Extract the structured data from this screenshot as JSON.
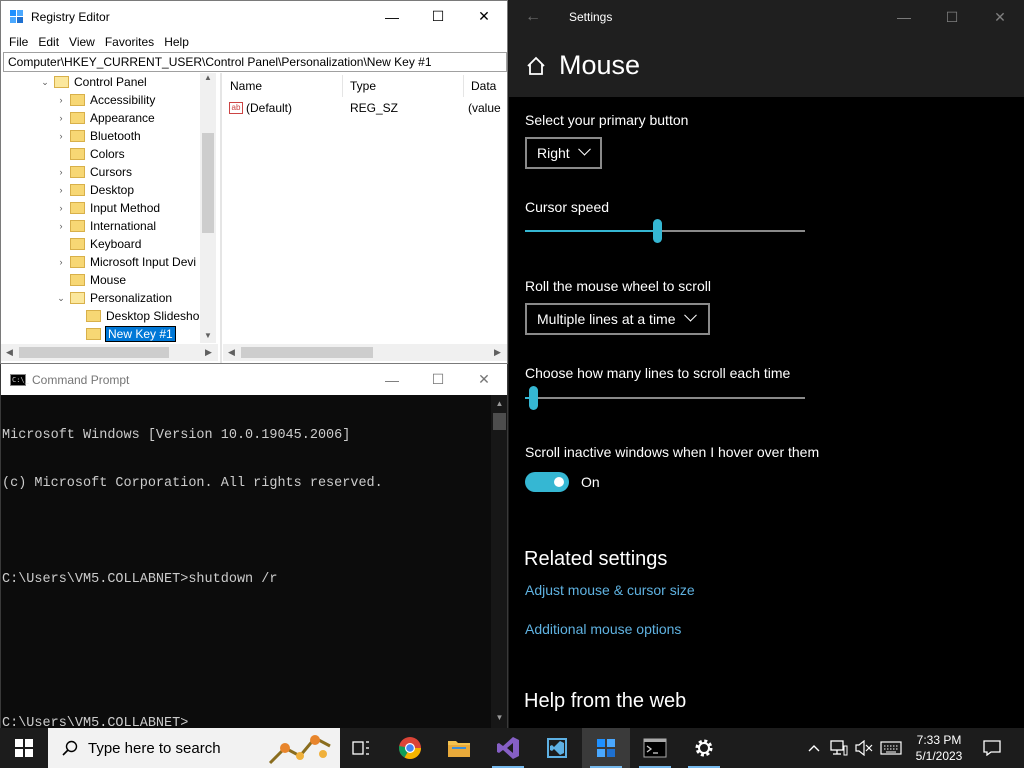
{
  "regedit": {
    "title": "Registry Editor",
    "controls": {
      "minimize": "—",
      "maximize": "☐",
      "close": "✕"
    },
    "menu": [
      "File",
      "Edit",
      "View",
      "Favorites",
      "Help"
    ],
    "address": "Computer\\HKEY_CURRENT_USER\\Control Panel\\Personalization\\New Key #1",
    "tree": [
      {
        "label": "Control Panel",
        "level": 0,
        "expander": "⌄",
        "open": true
      },
      {
        "label": "Accessibility",
        "level": 1,
        "expander": "›"
      },
      {
        "label": "Appearance",
        "level": 1,
        "expander": "›"
      },
      {
        "label": "Bluetooth",
        "level": 1,
        "expander": "›"
      },
      {
        "label": "Colors",
        "level": 1,
        "expander": ""
      },
      {
        "label": "Cursors",
        "level": 1,
        "expander": "›"
      },
      {
        "label": "Desktop",
        "level": 1,
        "expander": "›"
      },
      {
        "label": "Input Method",
        "level": 1,
        "expander": "›"
      },
      {
        "label": "International",
        "level": 1,
        "expander": "›"
      },
      {
        "label": "Keyboard",
        "level": 1,
        "expander": ""
      },
      {
        "label": "Microsoft Input Devi",
        "level": 1,
        "expander": "›"
      },
      {
        "label": "Mouse",
        "level": 1,
        "expander": ""
      },
      {
        "label": "Personalization",
        "level": 1,
        "expander": "⌄",
        "open": true
      },
      {
        "label": "Desktop Slidesho",
        "level": 2,
        "expander": ""
      },
      {
        "label": "New Key #1",
        "level": 2,
        "expander": "",
        "selected": true
      }
    ],
    "columns": [
      "Name",
      "Type",
      "Data"
    ],
    "values": [
      {
        "name": "(Default)",
        "type": "REG_SZ",
        "data": "(value",
        "icon": "ab"
      }
    ],
    "scroll_arrows": {
      "up": "▲",
      "down": "▼",
      "left": "◀",
      "right": "▶"
    }
  },
  "cmd": {
    "title": "Command Prompt",
    "icon_text": "C:\\_",
    "controls": {
      "minimize": "—",
      "maximize": "☐",
      "close": "✕"
    },
    "lines": [
      "Microsoft Windows [Version 10.0.19045.2006]",
      "(c) Microsoft Corporation. All rights reserved.",
      "",
      "C:\\Users\\VM5.COLLABNET>shutdown /r",
      "",
      "",
      "C:\\Users\\VM5.COLLABNET>"
    ],
    "scroll_arrows": {
      "up": "▲",
      "down": "▼"
    }
  },
  "settings": {
    "title": "Settings",
    "back_icon": "←",
    "controls": {
      "minimize": "—",
      "maximize": "☐",
      "close": "✕"
    },
    "page_title": "Mouse",
    "primary_button": {
      "label": "Select your primary button",
      "value": "Right"
    },
    "cursor_speed": {
      "label": "Cursor speed",
      "value_fraction": 0.47
    },
    "scroll": {
      "label": "Roll the mouse wheel to scroll",
      "value": "Multiple lines at a time"
    },
    "lines": {
      "label": "Choose how many lines to scroll each time",
      "value_fraction": 0.03
    },
    "inactive": {
      "label": "Scroll inactive windows when I hover over them",
      "state": "On"
    },
    "related": {
      "title": "Related settings",
      "links": [
        "Adjust mouse & cursor size",
        "Additional mouse options"
      ]
    },
    "help": {
      "title": "Help from the web"
    },
    "accent_color": "#35b7d3",
    "link_color": "#5fb2e1"
  },
  "taskbar": {
    "search_placeholder": "Type here to search",
    "pinned": [
      "task-view",
      "chrome",
      "file-explorer",
      "visual-studio",
      "visual-studio-installer",
      "registry-editor",
      "command-prompt",
      "settings"
    ],
    "clock": {
      "time": "7:33 PM",
      "date": "5/1/2023"
    }
  }
}
